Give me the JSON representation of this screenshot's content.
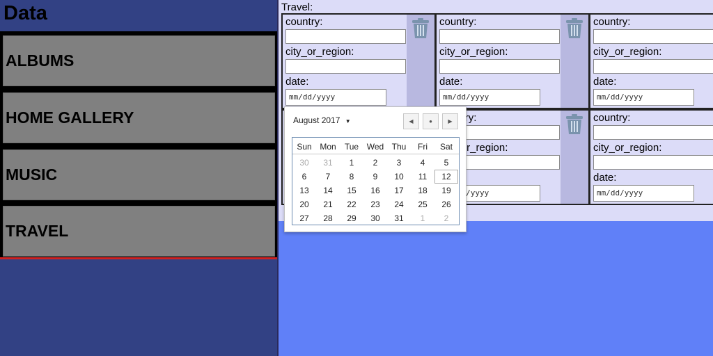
{
  "sidebar": {
    "title": "Data",
    "items": [
      {
        "label": "ALBUMS"
      },
      {
        "label": "HOME GALLERY"
      },
      {
        "label": "MUSIC"
      },
      {
        "label": "TRAVEL"
      }
    ]
  },
  "travel": {
    "section_label": "Travel:",
    "field_labels": {
      "country": "country:",
      "city": "city_or_region:",
      "date": "date:"
    },
    "date_placeholder": "mm/dd/yyyy",
    "card_count": 6
  },
  "datepicker": {
    "month_label": "August 2017",
    "weekdays": [
      "Sun",
      "Mon",
      "Tue",
      "Wed",
      "Thu",
      "Fri",
      "Sat"
    ],
    "weeks": [
      [
        "30",
        "31",
        "1",
        "2",
        "3",
        "4",
        "5"
      ],
      [
        "6",
        "7",
        "8",
        "9",
        "10",
        "11",
        "12"
      ],
      [
        "13",
        "14",
        "15",
        "16",
        "17",
        "18",
        "19"
      ],
      [
        "20",
        "21",
        "22",
        "23",
        "24",
        "25",
        "26"
      ],
      [
        "27",
        "28",
        "29",
        "30",
        "31",
        "1",
        "2"
      ]
    ],
    "today": "12",
    "prev_icon": "◀",
    "today_icon": "●",
    "next_icon": "▶"
  },
  "colors": {
    "sidebar_bg": "#324184",
    "main_bg": "#6080f8",
    "panel_bg": "#dcdcf8",
    "button_bg": "#808080",
    "accent_red": "#cc2222"
  }
}
